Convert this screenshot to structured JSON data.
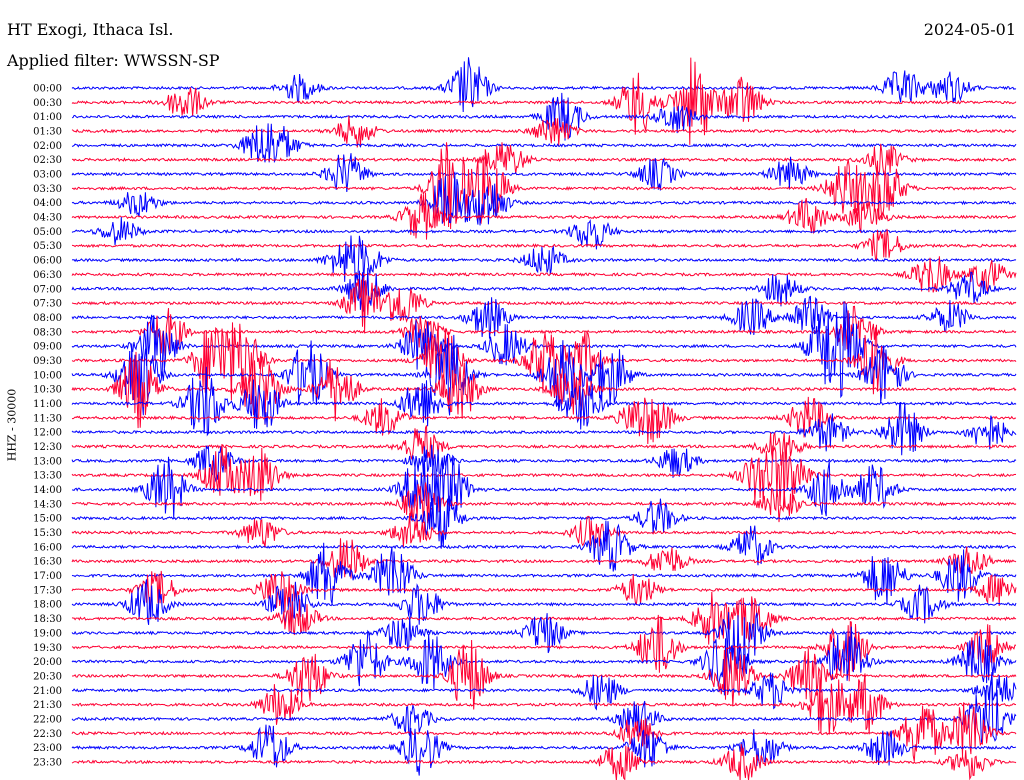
{
  "header": {
    "station": "HT Exogi, Ithaca Isl.",
    "date": "2024-05-01",
    "filter": "Applied filter: WWSSN-SP"
  },
  "chart_data": {
    "type": "line",
    "ylabel": "HHZ - 30000",
    "colors": [
      "#0000ff",
      "#ff0033"
    ],
    "grid": false,
    "rows": [
      {
        "label": "00:00",
        "events": [
          [
            0.42,
            0.55
          ],
          [
            0.24,
            0.25
          ],
          [
            0.88,
            0.35
          ],
          [
            0.93,
            0.3
          ]
        ]
      },
      {
        "label": "00:30",
        "events": [
          [
            0.12,
            0.35
          ],
          [
            0.6,
            0.6
          ],
          [
            0.66,
            0.85
          ],
          [
            0.71,
            0.5
          ]
        ]
      },
      {
        "label": "01:00",
        "events": [
          [
            0.52,
            0.45
          ],
          [
            0.64,
            0.3
          ]
        ]
      },
      {
        "label": "01:30",
        "events": [
          [
            0.3,
            0.3
          ],
          [
            0.51,
            0.3
          ]
        ]
      },
      {
        "label": "02:00",
        "events": [
          [
            0.2,
            0.35
          ],
          [
            0.22,
            0.3
          ]
        ]
      },
      {
        "label": "02:30",
        "events": [
          [
            0.46,
            0.35
          ],
          [
            0.86,
            0.3
          ]
        ]
      },
      {
        "label": "03:00",
        "events": [
          [
            0.29,
            0.4
          ],
          [
            0.62,
            0.3
          ],
          [
            0.76,
            0.3
          ]
        ]
      },
      {
        "label": "03:30",
        "events": [
          [
            0.4,
            0.9
          ],
          [
            0.44,
            0.7
          ],
          [
            0.82,
            0.55
          ],
          [
            0.86,
            0.6
          ]
        ]
      },
      {
        "label": "04:00",
        "events": [
          [
            0.4,
            0.6
          ],
          [
            0.44,
            0.5
          ],
          [
            0.07,
            0.25
          ]
        ]
      },
      {
        "label": "04:30",
        "events": [
          [
            0.37,
            0.45
          ],
          [
            0.78,
            0.35
          ],
          [
            0.84,
            0.3
          ]
        ]
      },
      {
        "label": "05:00",
        "events": [
          [
            0.55,
            0.35
          ],
          [
            0.05,
            0.25
          ]
        ]
      },
      {
        "label": "05:30",
        "events": [
          [
            0.86,
            0.3
          ]
        ]
      },
      {
        "label": "06:00",
        "events": [
          [
            0.29,
            0.35
          ],
          [
            0.31,
            0.3
          ],
          [
            0.5,
            0.3
          ]
        ]
      },
      {
        "label": "06:30",
        "events": [
          [
            0.91,
            0.4
          ],
          [
            0.97,
            0.3
          ]
        ]
      },
      {
        "label": "07:00",
        "events": [
          [
            0.31,
            0.4
          ],
          [
            0.75,
            0.3
          ],
          [
            0.95,
            0.3
          ]
        ]
      },
      {
        "label": "07:30",
        "events": [
          [
            0.31,
            0.5
          ],
          [
            0.35,
            0.45
          ]
        ]
      },
      {
        "label": "08:00",
        "events": [
          [
            0.44,
            0.4
          ],
          [
            0.72,
            0.35
          ],
          [
            0.78,
            0.4
          ],
          [
            0.93,
            0.3
          ]
        ]
      },
      {
        "label": "08:30",
        "events": [
          [
            0.1,
            0.45
          ],
          [
            0.37,
            0.3
          ],
          [
            0.83,
            0.45
          ]
        ]
      },
      {
        "label": "09:00",
        "events": [
          [
            0.09,
            0.6
          ],
          [
            0.37,
            0.5
          ],
          [
            0.46,
            0.4
          ],
          [
            0.8,
            0.7
          ],
          [
            0.82,
            0.6
          ]
        ]
      },
      {
        "label": "09:30",
        "events": [
          [
            0.15,
            0.75
          ],
          [
            0.18,
            0.7
          ],
          [
            0.39,
            0.7
          ],
          [
            0.5,
            0.6
          ],
          [
            0.54,
            0.55
          ],
          [
            0.85,
            0.65
          ]
        ]
      },
      {
        "label": "10:00",
        "events": [
          [
            0.07,
            0.8
          ],
          [
            0.25,
            0.7
          ],
          [
            0.4,
            0.75
          ],
          [
            0.52,
            0.7
          ],
          [
            0.57,
            0.6
          ],
          [
            0.86,
            0.6
          ]
        ]
      },
      {
        "label": "10:30",
        "events": [
          [
            0.07,
            0.7
          ],
          [
            0.2,
            0.7
          ],
          [
            0.28,
            0.6
          ],
          [
            0.41,
            0.6
          ],
          [
            0.53,
            0.5
          ]
        ]
      },
      {
        "label": "11:00",
        "events": [
          [
            0.14,
            0.7
          ],
          [
            0.2,
            0.55
          ],
          [
            0.37,
            0.5
          ],
          [
            0.54,
            0.5
          ]
        ]
      },
      {
        "label": "11:30",
        "events": [
          [
            0.33,
            0.35
          ],
          [
            0.6,
            0.35
          ],
          [
            0.62,
            0.3
          ],
          [
            0.78,
            0.4
          ]
        ]
      },
      {
        "label": "12:00",
        "events": [
          [
            0.88,
            0.55
          ],
          [
            0.8,
            0.35
          ],
          [
            0.97,
            0.35
          ]
        ]
      },
      {
        "label": "12:30",
        "events": [
          [
            0.37,
            0.4
          ],
          [
            0.75,
            0.35
          ]
        ]
      },
      {
        "label": "13:00",
        "events": [
          [
            0.15,
            0.35
          ],
          [
            0.38,
            0.3
          ],
          [
            0.64,
            0.3
          ]
        ]
      },
      {
        "label": "13:30",
        "events": [
          [
            0.16,
            0.55
          ],
          [
            0.2,
            0.5
          ],
          [
            0.73,
            0.55
          ],
          [
            0.76,
            0.6
          ]
        ]
      },
      {
        "label": "14:00",
        "events": [
          [
            0.1,
            0.6
          ],
          [
            0.37,
            0.7
          ],
          [
            0.4,
            0.6
          ],
          [
            0.8,
            0.5
          ],
          [
            0.85,
            0.45
          ]
        ]
      },
      {
        "label": "14:30",
        "events": [
          [
            0.37,
            0.4
          ],
          [
            0.75,
            0.35
          ]
        ]
      },
      {
        "label": "15:00",
        "events": [
          [
            0.39,
            0.55
          ],
          [
            0.62,
            0.35
          ]
        ]
      },
      {
        "label": "15:30",
        "events": [
          [
            0.2,
            0.3
          ],
          [
            0.36,
            0.35
          ],
          [
            0.55,
            0.3
          ]
        ]
      },
      {
        "label": "16:00",
        "events": [
          [
            0.57,
            0.5
          ],
          [
            0.72,
            0.4
          ]
        ]
      },
      {
        "label": "16:30",
        "events": [
          [
            0.29,
            0.45
          ],
          [
            0.63,
            0.3
          ],
          [
            0.95,
            0.3
          ]
        ]
      },
      {
        "label": "17:00",
        "events": [
          [
            0.27,
            0.65
          ],
          [
            0.34,
            0.6
          ],
          [
            0.86,
            0.55
          ],
          [
            0.94,
            0.5
          ]
        ]
      },
      {
        "label": "17:30",
        "events": [
          [
            0.22,
            0.45
          ],
          [
            0.09,
            0.35
          ],
          [
            0.6,
            0.3
          ],
          [
            0.98,
            0.3
          ]
        ]
      },
      {
        "label": "18:00",
        "events": [
          [
            0.08,
            0.45
          ],
          [
            0.23,
            0.5
          ],
          [
            0.37,
            0.4
          ],
          [
            0.9,
            0.35
          ]
        ]
      },
      {
        "label": "18:30",
        "events": [
          [
            0.68,
            0.5
          ],
          [
            0.72,
            0.45
          ],
          [
            0.24,
            0.35
          ]
        ]
      },
      {
        "label": "19:00",
        "events": [
          [
            0.71,
            0.8
          ],
          [
            0.5,
            0.4
          ],
          [
            0.35,
            0.35
          ]
        ]
      },
      {
        "label": "19:30",
        "events": [
          [
            0.62,
            0.6
          ],
          [
            0.82,
            0.65
          ],
          [
            0.97,
            0.4
          ]
        ]
      },
      {
        "label": "20:00",
        "events": [
          [
            0.31,
            0.6
          ],
          [
            0.38,
            0.55
          ],
          [
            0.69,
            0.6
          ],
          [
            0.82,
            0.7
          ],
          [
            0.96,
            0.5
          ]
        ]
      },
      {
        "label": "20:30",
        "events": [
          [
            0.25,
            0.55
          ],
          [
            0.42,
            0.7
          ],
          [
            0.7,
            0.6
          ],
          [
            0.78,
            0.5
          ]
        ]
      },
      {
        "label": "21:00",
        "events": [
          [
            0.56,
            0.35
          ],
          [
            0.74,
            0.35
          ],
          [
            0.98,
            0.35
          ]
        ]
      },
      {
        "label": "21:30",
        "events": [
          [
            0.22,
            0.4
          ],
          [
            0.8,
            0.6
          ],
          [
            0.84,
            0.55
          ]
        ]
      },
      {
        "label": "22:00",
        "events": [
          [
            0.97,
            0.7
          ],
          [
            0.6,
            0.35
          ],
          [
            0.36,
            0.3
          ]
        ]
      },
      {
        "label": "22:30",
        "events": [
          [
            0.9,
            0.7
          ],
          [
            0.6,
            0.35
          ],
          [
            0.95,
            0.6
          ]
        ]
      },
      {
        "label": "23:00",
        "events": [
          [
            0.21,
            0.5
          ],
          [
            0.37,
            0.5
          ],
          [
            0.61,
            0.4
          ],
          [
            0.73,
            0.4
          ],
          [
            0.86,
            0.35
          ]
        ]
      },
      {
        "label": "23:30",
        "events": [
          [
            0.58,
            0.35
          ],
          [
            0.95,
            0.3
          ],
          [
            0.71,
            0.35
          ]
        ]
      }
    ]
  }
}
